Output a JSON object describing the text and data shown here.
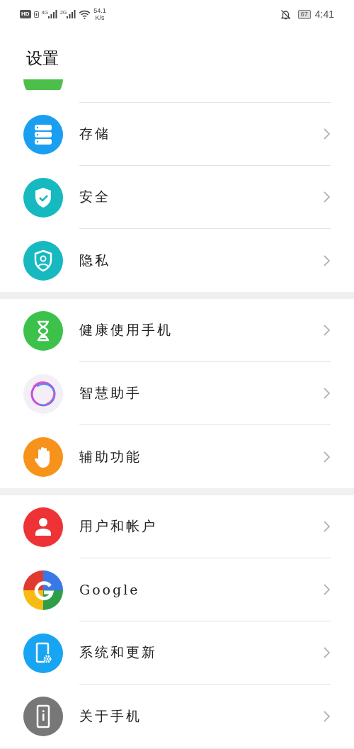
{
  "status_bar": {
    "hd": "HD",
    "signal_1": "4G",
    "signal_2": "2G",
    "speed": "54.1",
    "speed_unit": "K/s",
    "battery": "67",
    "time": "4:41"
  },
  "title": "设置",
  "groups": [
    {
      "items": [
        {
          "label": "存储"
        },
        {
          "label": "安全"
        },
        {
          "label": "隐私"
        }
      ]
    },
    {
      "items": [
        {
          "label": "健康使用手机"
        },
        {
          "label": "智慧助手"
        },
        {
          "label": "辅助功能"
        }
      ]
    },
    {
      "items": [
        {
          "label": "用户和帐户"
        },
        {
          "label": "Google"
        },
        {
          "label": "系统和更新"
        },
        {
          "label": "关于手机"
        }
      ]
    }
  ]
}
